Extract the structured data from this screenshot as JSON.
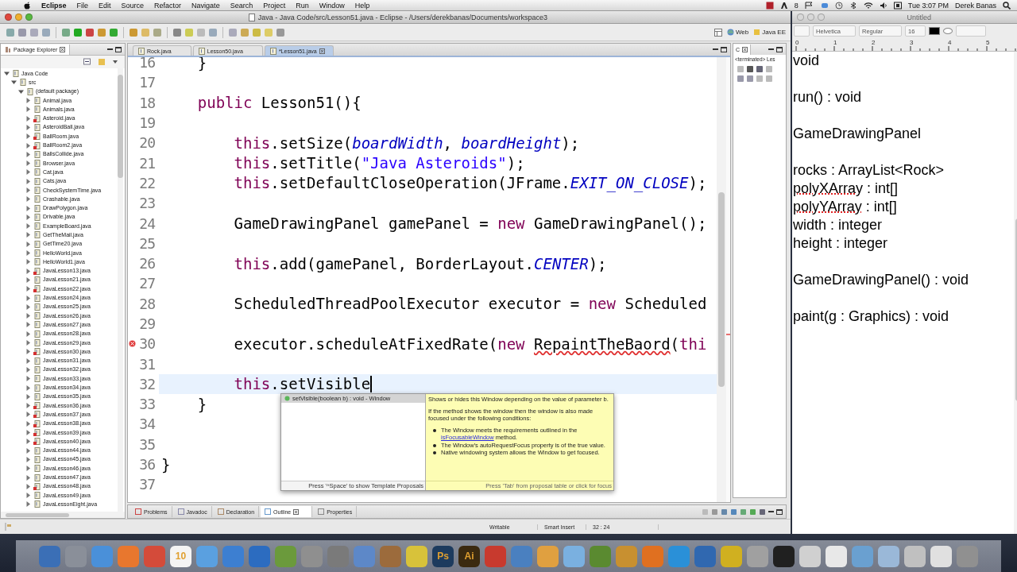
{
  "menu_bar": {
    "app": "Eclipse",
    "items": [
      "File",
      "Edit",
      "Source",
      "Refactor",
      "Navigate",
      "Search",
      "Project",
      "Run",
      "Window",
      "Help"
    ],
    "status_count": "8",
    "clock": "Tue 3:07 PM",
    "user": "Derek Banas"
  },
  "eclipse": {
    "title": "Java - Java Code/src/Lesson51.java - Eclipse - /Users/derekbanas/Documents/workspace3",
    "perspectives": [
      "Web",
      "Java EE"
    ],
    "package_explorer": {
      "title": "Package Explorer",
      "tree": [
        {
          "label": "Java Code",
          "expanded": true,
          "error": false,
          "children": [
            {
              "label": "src",
              "expanded": true,
              "error": false,
              "children": [
                {
                  "label": "(default package)",
                  "expanded": true,
                  "error": false,
                  "children": [
                    {
                      "label": "Animal.java",
                      "expanded": false,
                      "error": false
                    },
                    {
                      "label": "Animals.java",
                      "expanded": false,
                      "error": false
                    },
                    {
                      "label": "Asteroid.java",
                      "expanded": false,
                      "error": true
                    },
                    {
                      "label": "AsteroidBall.java",
                      "expanded": false,
                      "error": false
                    },
                    {
                      "label": "BallRoom.java",
                      "expanded": false,
                      "error": true
                    },
                    {
                      "label": "BallRoom2.java",
                      "expanded": false,
                      "error": true
                    },
                    {
                      "label": "BallsCollide.java",
                      "expanded": false,
                      "error": false
                    },
                    {
                      "label": "Browser.java",
                      "expanded": false,
                      "error": false
                    },
                    {
                      "label": "Cat.java",
                      "expanded": false,
                      "error": false
                    },
                    {
                      "label": "Cats.java",
                      "expanded": false,
                      "error": false
                    },
                    {
                      "label": "CheckSystemTime.java",
                      "expanded": false,
                      "error": false
                    },
                    {
                      "label": "Crashable.java",
                      "expanded": false,
                      "error": false
                    },
                    {
                      "label": "DrawPolygon.java",
                      "expanded": false,
                      "error": false
                    },
                    {
                      "label": "Drivable.java",
                      "expanded": false,
                      "error": false
                    },
                    {
                      "label": "ExampleBoard.java",
                      "expanded": false,
                      "error": false
                    },
                    {
                      "label": "GetTheMail.java",
                      "expanded": false,
                      "error": false
                    },
                    {
                      "label": "GetTime20.java",
                      "expanded": false,
                      "error": false
                    },
                    {
                      "label": "HelloWorld.java",
                      "expanded": false,
                      "error": false
                    },
                    {
                      "label": "HelloWorld1.java",
                      "expanded": false,
                      "error": false
                    },
                    {
                      "label": "JavaLesson13.java",
                      "expanded": false,
                      "error": true
                    },
                    {
                      "label": "JavaLesson21.java",
                      "expanded": false,
                      "error": false
                    },
                    {
                      "label": "JavaLesson22.java",
                      "expanded": false,
                      "error": true
                    },
                    {
                      "label": "JavaLesson24.java",
                      "expanded": false,
                      "error": false
                    },
                    {
                      "label": "JavaLesson25.java",
                      "expanded": false,
                      "error": false
                    },
                    {
                      "label": "JavaLesson26.java",
                      "expanded": false,
                      "error": false
                    },
                    {
                      "label": "JavaLesson27.java",
                      "expanded": false,
                      "error": false
                    },
                    {
                      "label": "JavaLesson28.java",
                      "expanded": false,
                      "error": false
                    },
                    {
                      "label": "JavaLesson29.java",
                      "expanded": false,
                      "error": false
                    },
                    {
                      "label": "JavaLesson30.java",
                      "expanded": false,
                      "error": true
                    },
                    {
                      "label": "JavaLesson31.java",
                      "expanded": false,
                      "error": false
                    },
                    {
                      "label": "JavaLesson32.java",
                      "expanded": false,
                      "error": false
                    },
                    {
                      "label": "JavaLesson33.java",
                      "expanded": false,
                      "error": false
                    },
                    {
                      "label": "JavaLesson34.java",
                      "expanded": false,
                      "error": false
                    },
                    {
                      "label": "JavaLesson35.java",
                      "expanded": false,
                      "error": false
                    },
                    {
                      "label": "JavaLesson36.java",
                      "expanded": false,
                      "error": true
                    },
                    {
                      "label": "JavaLesson37.java",
                      "expanded": false,
                      "error": true
                    },
                    {
                      "label": "JavaLesson38.java",
                      "expanded": false,
                      "error": true
                    },
                    {
                      "label": "JavaLesson39.java",
                      "expanded": false,
                      "error": true
                    },
                    {
                      "label": "JavaLesson40.java",
                      "expanded": false,
                      "error": true
                    },
                    {
                      "label": "JavaLesson44.java",
                      "expanded": false,
                      "error": false
                    },
                    {
                      "label": "JavaLesson45.java",
                      "expanded": false,
                      "error": false
                    },
                    {
                      "label": "JavaLesson46.java",
                      "expanded": false,
                      "error": false
                    },
                    {
                      "label": "JavaLesson47.java",
                      "expanded": false,
                      "error": false
                    },
                    {
                      "label": "JavaLesson48.java",
                      "expanded": false,
                      "error": true
                    },
                    {
                      "label": "JavaLesson49.java",
                      "expanded": false,
                      "error": false
                    },
                    {
                      "label": "JavaLessonEight.java",
                      "expanded": false,
                      "error": false
                    }
                  ]
                }
              ]
            }
          ]
        }
      ]
    },
    "editor": {
      "tabs": [
        {
          "label": "Rock.java",
          "selected": false
        },
        {
          "label": "Lesson50.java",
          "selected": false
        },
        {
          "label": "*Lesson51.java",
          "selected": true
        }
      ],
      "lines": [
        {
          "number": "16",
          "current": false,
          "error": false,
          "kind": "member",
          "tokens": [
            {
              "kind": "plain",
              "text": "}"
            }
          ]
        },
        {
          "number": "17",
          "current": false,
          "error": false,
          "kind": "blank"
        },
        {
          "number": "18",
          "current": false,
          "error": false,
          "kind": "member",
          "tokens": [
            {
              "kind": "keyword",
              "text": "public"
            },
            {
              "kind": "plain",
              "text": " Lesson51(){"
            }
          ]
        },
        {
          "number": "19",
          "current": false,
          "error": false,
          "kind": "blank"
        },
        {
          "number": "20",
          "current": false,
          "error": false,
          "kind": "statement",
          "tokens": [
            {
              "kind": "keyword",
              "text": "this"
            },
            {
              "kind": "plain",
              "text": ".setSize("
            },
            {
              "kind": "field",
              "text": "boardWidth"
            },
            {
              "kind": "plain",
              "text": ", "
            },
            {
              "kind": "field",
              "text": "boardHeight"
            },
            {
              "kind": "plain",
              "text": ");"
            }
          ]
        },
        {
          "number": "21",
          "current": false,
          "error": false,
          "kind": "statement",
          "tokens": [
            {
              "kind": "keyword",
              "text": "this"
            },
            {
              "kind": "plain",
              "text": ".setTitle("
            },
            {
              "kind": "string",
              "text": "\"Java Asteroids\""
            },
            {
              "kind": "plain",
              "text": ");"
            }
          ]
        },
        {
          "number": "22",
          "current": false,
          "error": false,
          "kind": "statement",
          "tokens": [
            {
              "kind": "keyword",
              "text": "this"
            },
            {
              "kind": "plain",
              "text": ".setDefaultCloseOperation(JFrame."
            },
            {
              "kind": "constant",
              "text": "EXIT_ON_CLOSE"
            },
            {
              "kind": "plain",
              "text": ");"
            }
          ]
        },
        {
          "number": "23",
          "current": false,
          "error": false,
          "kind": "blank"
        },
        {
          "number": "24",
          "current": false,
          "error": false,
          "kind": "statement",
          "tokens": [
            {
              "kind": "plain",
              "text": "GameDrawingPanel gamePanel = "
            },
            {
              "kind": "keyword",
              "text": "new"
            },
            {
              "kind": "plain",
              "text": " GameDrawingPanel();"
            }
          ]
        },
        {
          "number": "25",
          "current": false,
          "error": false,
          "kind": "blank"
        },
        {
          "number": "26",
          "current": false,
          "error": false,
          "kind": "statement",
          "tokens": [
            {
              "kind": "keyword",
              "text": "this"
            },
            {
              "kind": "plain",
              "text": ".add(gamePanel, BorderLayout."
            },
            {
              "kind": "constant",
              "text": "CENTER"
            },
            {
              "kind": "plain",
              "text": ");"
            }
          ]
        },
        {
          "number": "27",
          "current": false,
          "error": false,
          "kind": "blank"
        },
        {
          "number": "28",
          "current": false,
          "error": false,
          "kind": "statement",
          "tokens": [
            {
              "kind": "plain",
              "text": "ScheduledThreadPoolExecutor executor = "
            },
            {
              "kind": "keyword",
              "text": "new"
            },
            {
              "kind": "plain",
              "text": " Scheduled"
            }
          ]
        },
        {
          "number": "29",
          "current": false,
          "error": false,
          "kind": "blank"
        },
        {
          "number": "30",
          "current": false,
          "error": true,
          "kind": "statement",
          "tokens": [
            {
              "kind": "plain",
              "text": "executor.scheduleAtFixedRate("
            },
            {
              "kind": "keyword",
              "text": "new "
            },
            {
              "kind": "error",
              "text": "RepaintTheBaord"
            },
            {
              "kind": "plain",
              "text": "("
            },
            {
              "kind": "keyword",
              "text": "thi"
            }
          ]
        },
        {
          "number": "31",
          "current": false,
          "error": false,
          "kind": "blank"
        },
        {
          "number": "32",
          "current": true,
          "error": false,
          "kind": "statement",
          "tokens": [
            {
              "kind": "keyword",
              "text": "this"
            },
            {
              "kind": "plain",
              "text": ".setVisible"
            }
          ]
        },
        {
          "number": "33",
          "current": false,
          "error": false,
          "kind": "member",
          "tokens": [
            {
              "kind": "plain",
              "text": "}"
            }
          ]
        },
        {
          "number": "34",
          "current": false,
          "error": false,
          "kind": "blank"
        },
        {
          "number": "35",
          "current": false,
          "error": false,
          "kind": "blank"
        },
        {
          "number": "36",
          "current": false,
          "error": false,
          "kind": "top",
          "tokens": [
            {
              "kind": "plain",
              "text": "}"
            }
          ]
        },
        {
          "number": "37",
          "current": false,
          "error": false,
          "kind": "blank"
        }
      ]
    },
    "completion": {
      "proposals": [
        {
          "label": "setVisible(boolean b) : void - Window",
          "selected": true
        }
      ],
      "hint": "Press '^Space' to show Template Proposals",
      "paragraphs": [
        "Shows or hides this Window depending on the value of parameter b.",
        "If the method shows the window then the window is also made focused under the following conditions:"
      ],
      "bullets": [
        [
          {
            "text": "The Window meets the requirements outlined in the ",
            "link": false
          },
          {
            "text": "isFocusableWindow",
            "link": true
          },
          {
            "text": " method.",
            "link": false
          }
        ],
        [
          {
            "text": "The Window's autoRequestFocus property is of the true value.",
            "link": false
          }
        ],
        [
          {
            "text": "Native windowing system allows the Window to get focused.",
            "link": false
          }
        ]
      ],
      "doc_hint": "Press 'Tab' from proposal table or click for focus"
    },
    "console": {
      "tab": "C",
      "status": "<terminated> Les"
    },
    "bottom_tabs": [
      {
        "label": "Problems",
        "selected": false
      },
      {
        "label": "Javadoc",
        "selected": false
      },
      {
        "label": "Declaration",
        "selected": false
      },
      {
        "label": "Outline",
        "selected": true
      },
      {
        "label": "Properties",
        "selected": false
      }
    ],
    "status_bar": [
      "Writable",
      "Smart Insert",
      "32 : 24"
    ]
  },
  "textedit": {
    "title": "Untitled",
    "font": "Helvetica",
    "style": "Regular",
    "size": "16",
    "ruler": [
      "0",
      "1",
      "2",
      "3",
      "4",
      "5"
    ],
    "paragraphs": [
      {
        "lines": [
          [
            {
              "text": "void",
              "misspelled": false
            }
          ]
        ]
      },
      {
        "lines": [
          [
            {
              "text": "run() : void",
              "misspelled": false
            }
          ]
        ]
      },
      {
        "lines": [
          [
            {
              "text": "GameDrawingPanel",
              "misspelled": false
            }
          ]
        ]
      },
      {
        "lines": [
          [
            {
              "text": "rocks : ArrayList<Rock>",
              "misspelled": false
            }
          ],
          [
            {
              "text": "polyXArray",
              "misspelled": true
            },
            {
              "text": " : int[]",
              "misspelled": false
            }
          ],
          [
            {
              "text": "polyYArray",
              "misspelled": true
            },
            {
              "text": " : int[]",
              "misspelled": false
            }
          ],
          [
            {
              "text": "width : integer",
              "misspelled": false
            }
          ],
          [
            {
              "text": "height : integer",
              "misspelled": false
            }
          ]
        ]
      },
      {
        "lines": [
          [
            {
              "text": "GameDrawingPanel() : void",
              "misspelled": false
            }
          ]
        ]
      },
      {
        "lines": [
          [
            {
              "text": "paint(g : Graphics) : void",
              "misspelled": false
            }
          ]
        ]
      }
    ]
  },
  "dock": [
    {
      "color": "#3b6fb6"
    },
    {
      "color": "#8a8f99"
    },
    {
      "color": "#4a90d9"
    },
    {
      "color": "#e8772e"
    },
    {
      "color": "#d44b3a"
    },
    {
      "color": "#f4f4f4",
      "label": "10"
    },
    {
      "color": "#5aa0e0"
    },
    {
      "color": "#3d7fd1"
    },
    {
      "color": "#2c6cc0"
    },
    {
      "color": "#6b9a3c"
    },
    {
      "color": "#8f8f8f"
    },
    {
      "color": "#7a7a7a"
    },
    {
      "color": "#5d88c8"
    },
    {
      "color": "#9c6b3c"
    },
    {
      "color": "#d8c23a"
    },
    {
      "color": "#1d3b5e",
      "label": "Ps"
    },
    {
      "color": "#3b2a10",
      "label": "Ai"
    },
    {
      "color": "#c83a2e"
    },
    {
      "color": "#4a80c0"
    },
    {
      "color": "#e0a040"
    },
    {
      "color": "#7ab0e0"
    },
    {
      "color": "#5a8a30"
    },
    {
      "color": "#c89030"
    },
    {
      "color": "#e07020"
    },
    {
      "color": "#2a90d8"
    },
    {
      "color": "#3068b0"
    },
    {
      "color": "#d0b020"
    },
    {
      "color": "#a0a0a0"
    },
    {
      "color": "#202020"
    },
    {
      "color": "#d0d0d0"
    },
    {
      "color": "#e8e8e8"
    },
    {
      "color": "#6aa0d0"
    },
    {
      "color": "#9ab8d8"
    },
    {
      "color": "#c0c0c0"
    },
    {
      "color": "#e0e0e0"
    },
    {
      "color": "#909090"
    }
  ]
}
